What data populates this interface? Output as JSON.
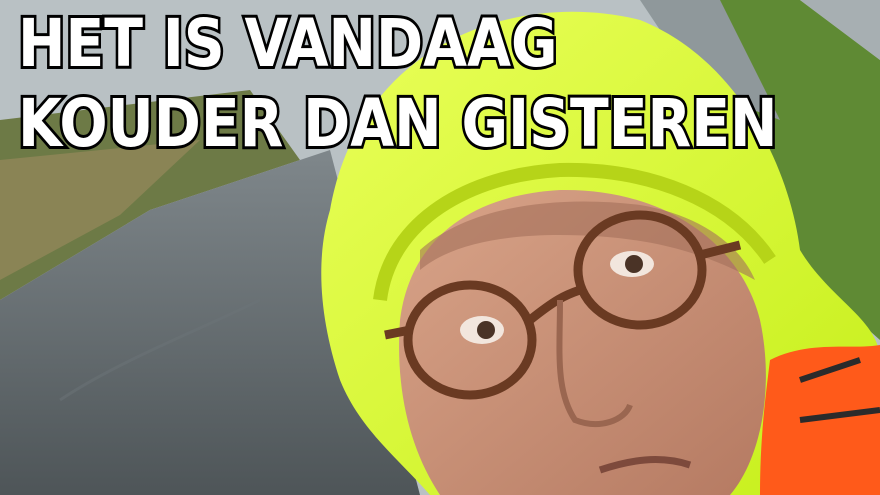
{
  "meme": {
    "caption_lines": [
      "HET IS VANDAAG",
      "KOUDER DAN GISTEREN"
    ]
  },
  "colors": {
    "sky": "#c9cfd2",
    "road": "#5d6468",
    "grass": "#6f8a3e",
    "jacket": "#d8ff2a",
    "orange_vest": "#ff5a1a",
    "caption_text": "#ffffff",
    "caption_outline": "#000000"
  }
}
